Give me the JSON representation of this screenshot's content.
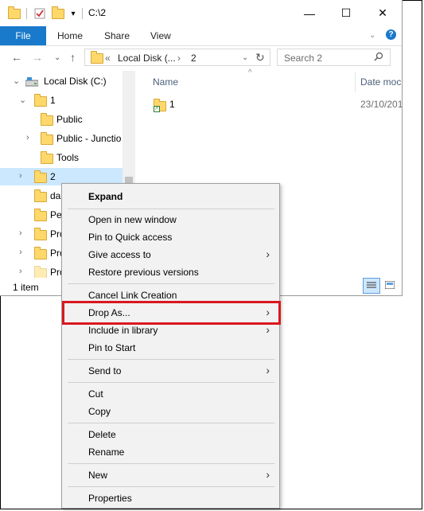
{
  "window": {
    "title": "C:\\2",
    "controls": {
      "minimize": "—",
      "maximize": "☐",
      "close": "✕"
    }
  },
  "ribbon": {
    "tabs": [
      "File",
      "Home",
      "Share",
      "View"
    ],
    "expand_glyph": "⌄",
    "help_glyph": "?"
  },
  "address_bar": {
    "overflow": "«",
    "crumbs": [
      "Local Disk (...",
      "2"
    ],
    "separator": "›",
    "dropdown_glyph": "⌄",
    "refresh_glyph": "↻"
  },
  "search": {
    "placeholder": "Search 2",
    "icon": "search-icon"
  },
  "nav_buttons": {
    "back": "←",
    "forward": "→",
    "recent": "⌄",
    "up": "↑"
  },
  "tree": [
    {
      "label": "Local Disk (C:)",
      "icon": "drive-icon",
      "chevron": "⌄"
    },
    {
      "label": "1",
      "icon": "folder-icon",
      "chevron": "⌄"
    },
    {
      "label": "Public",
      "icon": "folder-icon",
      "chevron": ""
    },
    {
      "label": "Public - Junctio",
      "icon": "junction-folder-icon",
      "chevron": "›"
    },
    {
      "label": "Tools",
      "icon": "folder-icon",
      "chevron": ""
    },
    {
      "label": "2",
      "icon": "folder-icon",
      "chevron": "›",
      "selected": true
    },
    {
      "label": "da",
      "icon": "folder-icon",
      "chevron": ""
    },
    {
      "label": "Pe",
      "icon": "folder-icon",
      "chevron": ""
    },
    {
      "label": "Pro",
      "icon": "folder-icon",
      "chevron": "›"
    },
    {
      "label": "Pro",
      "icon": "folder-icon",
      "chevron": "›"
    },
    {
      "label": "Pro",
      "icon": "folder-icon",
      "chevron": "›"
    }
  ],
  "file_list": {
    "columns": [
      "Name",
      "Date moc"
    ],
    "sort_glyph": "^",
    "rows": [
      {
        "name": "1",
        "date": "23/10/201"
      }
    ]
  },
  "status": {
    "text": "1 item"
  },
  "context_menu": {
    "items": [
      {
        "label": "Expand",
        "bold": true
      },
      {
        "label": "Open in new window"
      },
      {
        "label": "Pin to Quick access"
      },
      {
        "label": "Give access to",
        "submenu": true
      },
      {
        "label": "Restore previous versions"
      },
      {
        "label": "Cancel Link Creation"
      },
      {
        "label": "Drop As...",
        "submenu": true,
        "highlighted": true
      },
      {
        "label": "Include in library",
        "submenu": true
      },
      {
        "label": "Pin to Start"
      },
      {
        "label": "Send to",
        "submenu": true
      },
      {
        "label": "Cut"
      },
      {
        "label": "Copy"
      },
      {
        "label": "Delete"
      },
      {
        "label": "Rename"
      },
      {
        "label": "New",
        "submenu": true
      },
      {
        "label": "Properties"
      }
    ],
    "submenu_glyph": "›"
  },
  "colors": {
    "accent": "#1979ca",
    "selection": "#cce8ff",
    "highlight_box": "#d9181f",
    "folder": "#ffd86b"
  }
}
